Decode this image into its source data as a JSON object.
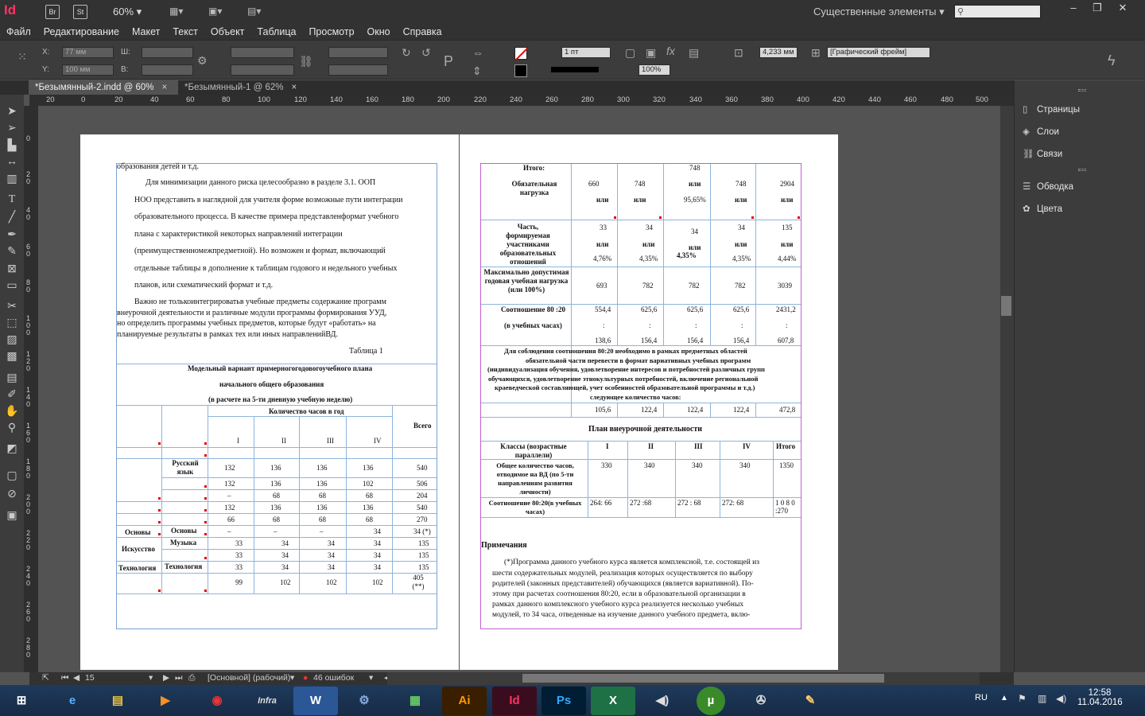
{
  "app": {
    "logo": "Id",
    "bridge": "Br",
    "stock": "St",
    "zoom": "60%",
    "workspace": "Существенные элементы",
    "colors": {
      "brand": "#ff3366",
      "chrome": "#323232",
      "panel": "#3c3c3c",
      "pasteboard": "#535353"
    }
  },
  "menu": [
    "Файл",
    "Редактирование",
    "Макет",
    "Текст",
    "Объект",
    "Таблица",
    "Просмотр",
    "Окно",
    "Справка"
  ],
  "control": {
    "x_label": "X:",
    "x_value": "77 мм",
    "y_label": "Y:",
    "y_value": "100 мм",
    "w_label": "Ш:",
    "h_label": "В:",
    "stroke_weight": "1 пт",
    "opacity": "100%",
    "size_value": "4,233 мм",
    "frame_type": "[Графический фрейм]"
  },
  "tabs": [
    {
      "label": "*Безымянный-2.indd @ 60%",
      "active": true
    },
    {
      "label": "*Безымянный-1 @ 62%",
      "active": false
    }
  ],
  "ruler_h": [
    "20",
    "0",
    "20",
    "40",
    "60",
    "80",
    "100",
    "120",
    "140",
    "160",
    "180",
    "200",
    "220",
    "240",
    "260",
    "280",
    "300",
    "320",
    "340",
    "360",
    "380",
    "400",
    "420",
    "440",
    "460",
    "480",
    "500"
  ],
  "ruler_v": [
    "0",
    "2 0",
    "4 0",
    "6 0",
    "8 0",
    "1 0 0",
    "1 2 0",
    "1 4 0",
    "1 6 0",
    "1 8 0",
    "2 0 0",
    "2 2 0",
    "2 4 0",
    "2 6 0",
    "2 8 0"
  ],
  "panels": [
    "Страницы",
    "Слои",
    "Связи",
    "Обводка",
    "Цвета"
  ],
  "status": {
    "page": "15",
    "master": "[Основной] (рабочий)",
    "errors": "46 ошибок"
  },
  "taskbar": {
    "lang": "RU",
    "time": "12:58",
    "date": "11.04.2016"
  },
  "page1": {
    "line1": "образования детей и т.д.",
    "line2": "Для минимизации данного риска целесообразно в разделе 3.1. ООП",
    "line3": "НОО представить в наглядной для учителя форме возможные пути интеграции",
    "line4": "образовательного процесса. В качестве примера представленформат учебного",
    "line5": "плана с характеристикой некоторых направлений  интеграции",
    "line6": "(преимущественномежпредметной). Но возможен и формат, включающий",
    "line7": "отдельные таблицы в дополнение к таблицам годового и недельного учебных",
    "line8": "планов,  или схематический формат и т.д.",
    "para2_1": "Важно  не  толькоинтегрироватьв  учебные  предметы  содержание  программ",
    "para2_2": "внеурочной  деятельности  и  различные  модули  программы  формирования  УУД,",
    "para2_3": "но  определить  программы  учебных  предметов,  которые  будут  «работать»  на",
    "para2_4": "планируемые результаты в рамках тех или иных направленийВД.",
    "table_caption": "Таблица 1",
    "table_title1": "Модельный вариант примерногогодовогоучебного плана",
    "table_title2": "начального общего образования",
    "table_title3": "(в расчете на 5-ти дневную учебную неделю)",
    "hours_header": "Количество часов в год",
    "total_header": "Всего",
    "grades": [
      "I",
      "II",
      "III",
      "IV"
    ],
    "rows": [
      {
        "c1": "",
        "c2": "Русский язык",
        "v": [
          "132",
          "136",
          "136",
          "136",
          "540"
        ]
      },
      {
        "c1": "",
        "c2": "",
        "v": [
          "132",
          "136",
          "136",
          "102",
          "506"
        ]
      },
      {
        "c1": "",
        "c2": "",
        "v": [
          "–",
          "68",
          "68",
          "68",
          "204"
        ]
      },
      {
        "c1": "",
        "c2": "",
        "v": [
          "132",
          "136",
          "136",
          "136",
          "540"
        ]
      },
      {
        "c1": "",
        "c2": "",
        "v": [
          "66",
          "68",
          "68",
          "68",
          "270"
        ]
      },
      {
        "c1": "Основы",
        "c2": "Основы",
        "v": [
          "–",
          "–",
          "–",
          "34",
          "34 (*)"
        ]
      },
      {
        "c1": "Искусство",
        "c2": "Музыка",
        "v": [
          "33",
          "34",
          "34",
          "34",
          "135"
        ]
      },
      {
        "c1": "",
        "c2": "",
        "v": [
          "33",
          "34",
          "34",
          "34",
          "135"
        ]
      },
      {
        "c1": "Технология",
        "c2": "Технология",
        "v": [
          "33",
          "34",
          "34",
          "34",
          "135"
        ]
      },
      {
        "c1": "",
        "c2": "",
        "v": [
          "99",
          "102",
          "102",
          "102",
          "405 (**)"
        ]
      }
    ]
  },
  "page2": {
    "itogo": "Итого:",
    "mandatory": "Обязательная нагрузка",
    "mandatory_vals": [
      "660",
      "748",
      "748",
      "748",
      "2904"
    ],
    "ili": "или",
    "pct_9565": "95,65%",
    "part_label": "Часть, формируемая участниками образовательных отношений",
    "part_vals": [
      "33",
      "34",
      "34",
      "34",
      "135"
    ],
    "part_pct": [
      "4,76%",
      "4,35%",
      "4,35%",
      "4,35%",
      "4,44%"
    ],
    "max_label": "Максимально допустимая годовая учебная нагрузка  (или 100%)",
    "max_vals": [
      "693",
      "782",
      "782",
      "782",
      "3039"
    ],
    "ratio_label1": "Соотношение 80 :20",
    "ratio_label2": "(в учебных часах)",
    "ratio_top": [
      "554,4",
      "625,6",
      "625,6",
      "625,6",
      "2431,2"
    ],
    "ratio_bot": [
      "138,6",
      "156,4",
      "156,4",
      "156,4",
      "607,8"
    ],
    "note_line1": "Для соблюдения соотношения 80:20 необходимо в рамках предметных областей",
    "note_line2": "обязательной части перевести в формат вариативных учебных программ",
    "note_line3": "(индивидуализация обучения, удовлетворение интересов и потребностей различных групп",
    "note_line4": "обучающихся, удовлетворение этнокультурных потребностей,  включение региональной",
    "note_line5": "краеведческой  составляющей, учет особенностей образовательной программы и т.д.)",
    "note_line6": "следующее количество часов:",
    "extra_vals": [
      "105,6",
      "122,4",
      "122,4",
      "122,4",
      "472,8"
    ],
    "plan_title": "План внеурочной деятельности",
    "plan_head": [
      "Классы (возрастные параллели)",
      "I",
      "II",
      "III",
      "IV",
      "Итого"
    ],
    "plan_row1_label": "Общее количество часов, отводимое на ВД  (по 5-ти направлениям развития личности)",
    "plan_row1": [
      "330",
      "340",
      "340",
      "340",
      "1350"
    ],
    "plan_row2_label": "Соотношение 80:20(в учебных часах)",
    "plan_row2": [
      "264: 66",
      "272 :68",
      "272 : 68",
      "272: 68",
      "1 0 8 0 :270"
    ],
    "notes_title": "Примечания",
    "notes_1": "(*)Программа данного учебного курса является комплексной, т.е. состоящей из",
    "notes_2": "шести содержательных модулей, реализация которых осуществляется по выбору",
    "notes_3": "родителей (законных представителей) обучающихся (является вариативной).  По-",
    "notes_4": "этому при расчетах соотношения 80:20, если в образовательной организации в",
    "notes_5": "рамках  данного  комплексного  учебного  курса  реализуется  несколько  учебных",
    "notes_6": "модулей, то 34 часа, отведенные на изучение данного учебного предмета, вклю-"
  }
}
